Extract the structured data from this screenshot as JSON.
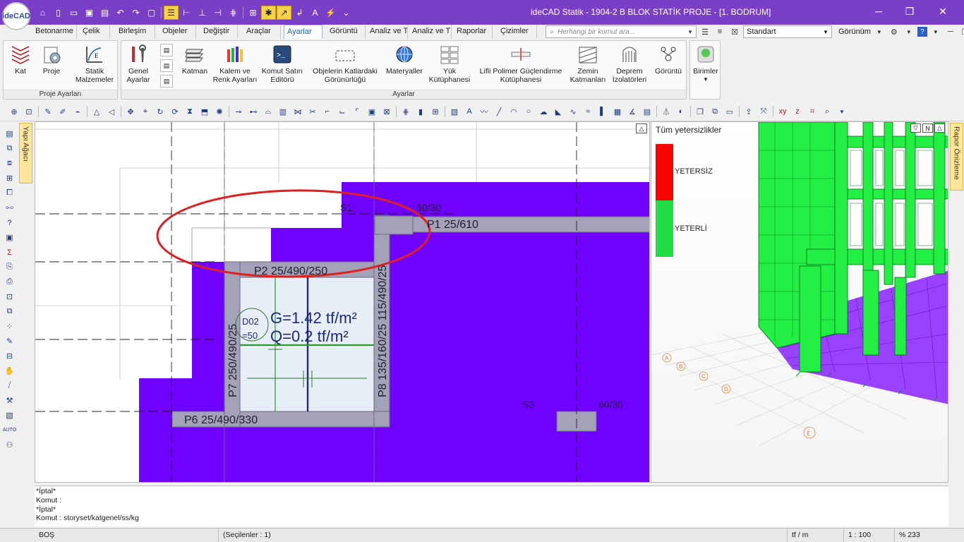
{
  "app": {
    "logo_text": "ideCAD",
    "window_title": "ideCAD Statik - 1904-2 B BLOK STATİK PROJE - [1. BODRUM]"
  },
  "quick_access": [
    "home-icon",
    "new-file-icon",
    "open-icon",
    "save-icon",
    "save-all-icon",
    "undo-icon",
    "redo-icon",
    "screenshot-icon",
    "layers-icon",
    "snap-icon",
    "ortho-icon",
    "polar-icon",
    "track-icon",
    "grid-icon",
    "snap-star-icon",
    "snap-end-icon",
    "snap-perp-icon",
    "snap-as-icon",
    "lightning-icon"
  ],
  "tabs": [
    "Betonarme",
    "Çelik",
    "Birleşim",
    "Objeler",
    "Değiştir",
    "Araçlar",
    "Ayarlar",
    "Görüntü",
    "Analiz ve T",
    "Analiz ve T",
    "Raporlar",
    "Çizimler"
  ],
  "active_tab": "Ayarlar",
  "search": {
    "placeholder": "Herhangi bir komut ara..."
  },
  "style_select": {
    "value": "Standart"
  },
  "view_menu": {
    "label": "Görünüm"
  },
  "ribbon": {
    "group1": {
      "label": "Proje Ayarları",
      "buttons": [
        {
          "label": "Kat",
          "icon": "floor-icon"
        },
        {
          "label": "Proje",
          "icon": "project-icon"
        },
        {
          "label": "Statik\nMalzemeler",
          "icon": "material-icon"
        }
      ]
    },
    "group2": {
      "label": "Ayarlar",
      "buttons": [
        {
          "label": "Genel\nAyarlar",
          "icon": "tools-icon"
        },
        {
          "label": "Katman",
          "icon": "layer-stack-icon"
        },
        {
          "label": "Kalem ve\nRenk Ayarları",
          "icon": "pencils-icon"
        },
        {
          "label": "Komut Satırı\nEditörü",
          "icon": "command-line-icon"
        },
        {
          "label": "Objelerin Katlardaki\nGörünürlüğü",
          "icon": "visibility-icon"
        },
        {
          "label": "Materyaller",
          "icon": "globe-icon"
        },
        {
          "label": "Yük\nKütüphanesi",
          "icon": "load-library-icon"
        },
        {
          "label": "Lifli Polimer Güçlendirme\nKütüphanesi",
          "icon": "frp-icon"
        },
        {
          "label": "Zemin\nKatmanları",
          "icon": "soil-icon"
        },
        {
          "label": "Deprem\nİzolatörleri",
          "icon": "isolator-icon"
        },
        {
          "label": "Görüntü",
          "icon": "display-icon"
        }
      ]
    },
    "units": {
      "label": "Birimler",
      "icon": "units-icon"
    }
  },
  "side_tabs": {
    "left": "Yapı Ağacı",
    "right": "Rapor Önizleme"
  },
  "drawing": {
    "labels": {
      "s1": "S1",
      "s1_dim": "60/30",
      "s3": "S3",
      "s3_dim": "60/30",
      "p1": "P1 25/610",
      "p2": "P2 25/490/250",
      "p6": "P6 25/490/330",
      "p7": "P7 250/490/25",
      "p8": "P8 135/160/25 115/490/25",
      "load_g": "G=1.42 tf/m²",
      "load_q": "Q=0.2 tf/m²",
      "slab_id": "D02",
      "slab_h": "=50"
    }
  },
  "results_panel": {
    "title": "Tüm yetersizlikler",
    "legend": [
      {
        "label": "YETERSİZ",
        "color": "#ff0000"
      },
      {
        "label": "YETERLİ",
        "color": "#22dd44"
      }
    ],
    "axis_labels": [
      "A",
      "B",
      "C",
      "D",
      "E"
    ]
  },
  "command_lines": [
    "*İptal*",
    "Komut :",
    "*İptal*",
    "Komut : storyset/katgenel/ss/kg"
  ],
  "status": {
    "mode": "BOŞ",
    "selected": "(Seçilenler : 1)",
    "units": "tf / m",
    "scale": "1 : 100",
    "zoom": "% 233"
  },
  "colors": {
    "title_bar": "#7a3fc6",
    "slab_fill": "#7000ff",
    "wall_fill": "#a4a2b8",
    "highlight_ellipse": "#e02020",
    "load_text": "#1a2a7a"
  }
}
